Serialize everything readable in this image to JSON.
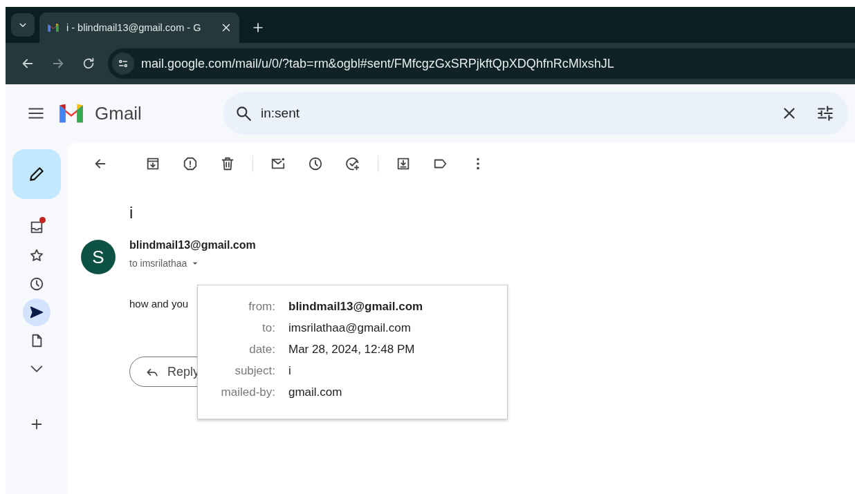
{
  "browser": {
    "tab": {
      "title": "i - blindmail13@gmail.com - G",
      "selected": true
    },
    "address": "mail.google.com/mail/u/0/?tab=rm&ogbl#sent/FMfcgzGxSRPjkftQpXDQhfnRcMlxshJL"
  },
  "app": {
    "name": "Gmail",
    "search": {
      "value": "in:sent"
    }
  },
  "sidebar": {
    "items": [
      {
        "kind": "inbox",
        "selected": false,
        "unread_dot": true
      },
      {
        "kind": "starred",
        "selected": false,
        "unread_dot": false
      },
      {
        "kind": "snoozed",
        "selected": false,
        "unread_dot": false
      },
      {
        "kind": "sent",
        "selected": true,
        "unread_dot": false
      },
      {
        "kind": "drafts",
        "selected": false,
        "unread_dot": false
      },
      {
        "kind": "more",
        "selected": false,
        "unread_dot": false
      }
    ]
  },
  "message": {
    "subject": "i",
    "avatar": "S",
    "sender": "blindmail13@gmail.com",
    "recipient_line": "to imsrilathaa",
    "body": "how and you",
    "reply": "Reply"
  },
  "details_popup": {
    "rows": [
      {
        "label": "from:",
        "value": "blindmail13@gmail.com",
        "emphasis": true
      },
      {
        "label": "to:",
        "value": "imsrilathaa@gmail.com",
        "emphasis": false
      },
      {
        "label": "date:",
        "value": "Mar 28, 2024, 12:48 PM",
        "emphasis": false
      },
      {
        "label": "subject:",
        "value": "i",
        "emphasis": false
      },
      {
        "label": "mailed-by:",
        "value": "gmail.com",
        "emphasis": false
      }
    ]
  }
}
